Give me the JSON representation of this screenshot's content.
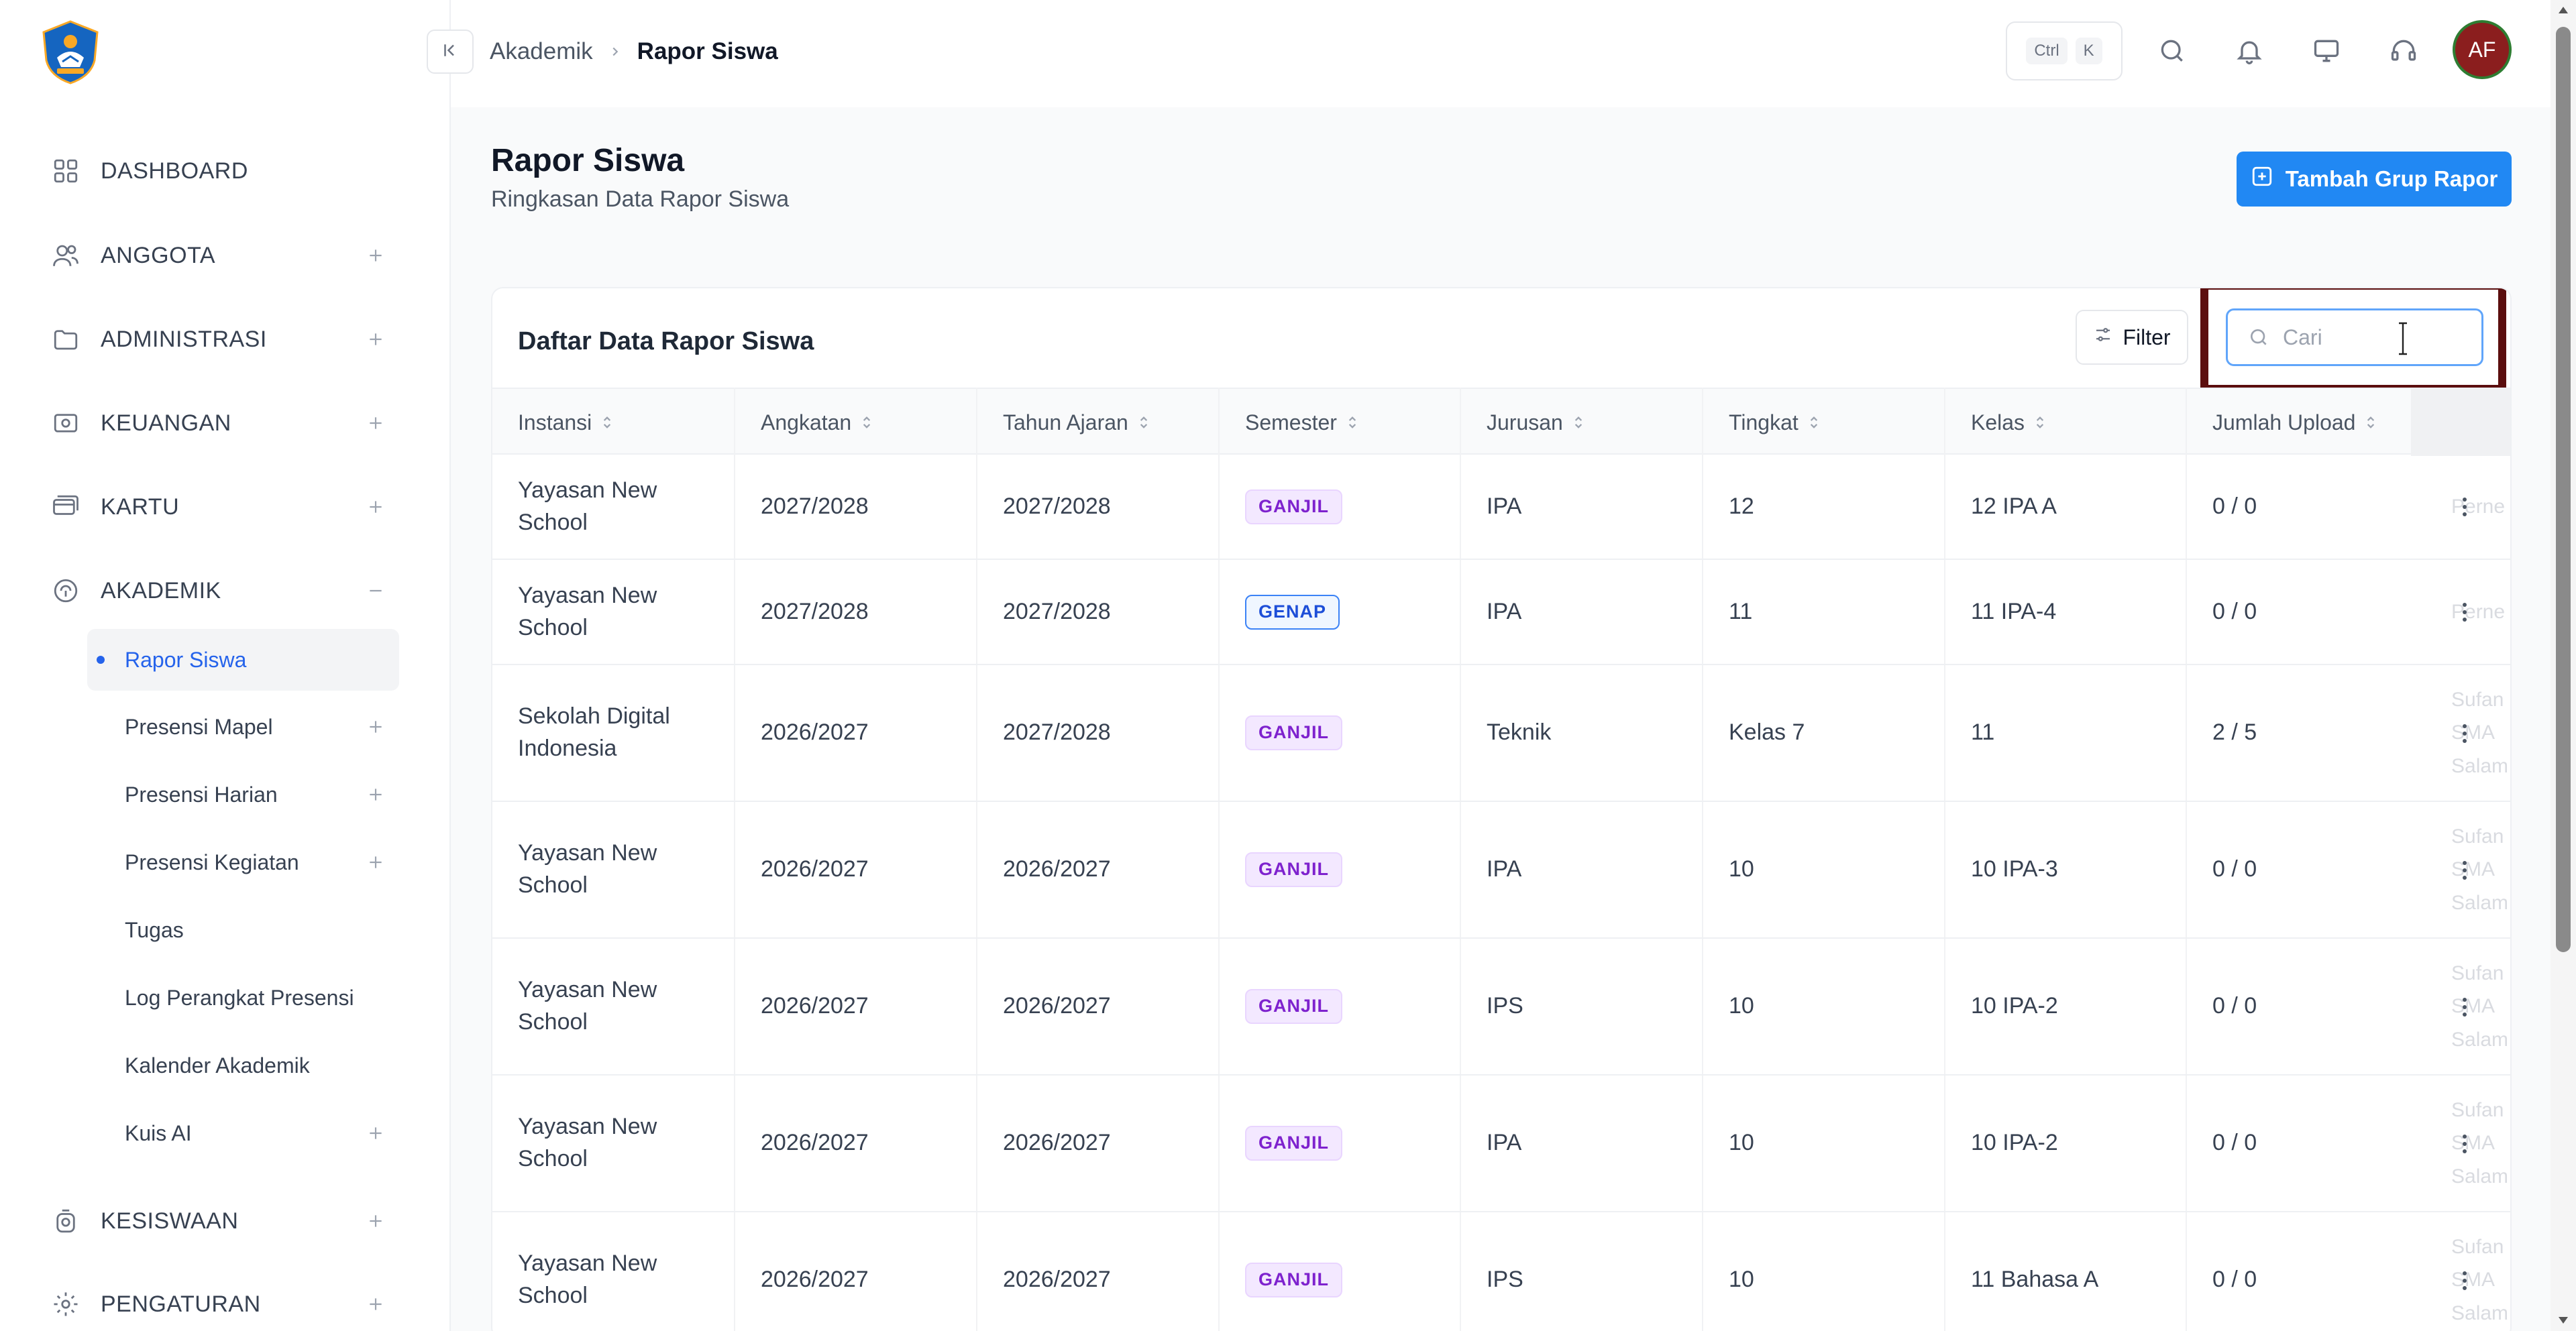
{
  "sidebar": {
    "items": [
      {
        "label": "DASHBOARD",
        "icon": "dashboard-grid-icon"
      },
      {
        "label": "ANGGOTA",
        "icon": "users-icon"
      },
      {
        "label": "ADMINISTRASI",
        "icon": "folder-icon"
      },
      {
        "label": "KEUANGAN",
        "icon": "money-icon"
      },
      {
        "label": "KARTU",
        "icon": "card-icon"
      },
      {
        "label": "AKADEMIK",
        "icon": "academic-icon"
      },
      {
        "label": "KESISWAAN",
        "icon": "student-icon"
      },
      {
        "label": "PENGATURAN",
        "icon": "settings-icon"
      }
    ],
    "subitems": [
      {
        "label": "Rapor Siswa",
        "active": true
      },
      {
        "label": "Presensi Mapel"
      },
      {
        "label": "Presensi Harian"
      },
      {
        "label": "Presensi Kegiatan"
      },
      {
        "label": "Tugas"
      },
      {
        "label": "Log Perangkat Presensi"
      },
      {
        "label": "Kalender Akademik"
      },
      {
        "label": "Kuis AI"
      }
    ]
  },
  "header": {
    "breadcrumb_parent": "Akademik",
    "breadcrumb_current": "Rapor Siswa",
    "shortcut_ctrl": "Ctrl",
    "shortcut_key": "K",
    "avatar_initials": "AF"
  },
  "page": {
    "title": "Rapor Siswa",
    "subtitle": "Ringkasan Data Rapor Siswa",
    "add_button": "Tambah Grup Rapor"
  },
  "card": {
    "title": "Daftar Data Rapor Siswa",
    "filter_label": "Filter",
    "search_placeholder": "Cari"
  },
  "table": {
    "columns": [
      "Instansi",
      "Angkatan",
      "Tahun Ajaran",
      "Semester",
      "Jurusan",
      "Tingkat",
      "Kelas",
      "Jumlah Upload"
    ],
    "rows": [
      {
        "instansi": "Yayasan New School",
        "angkatan": "2027/2028",
        "tahun": "2027/2028",
        "semester": "GANJIL",
        "jurusan": "IPA",
        "tingkat": "12",
        "kelas": "12 IPA A",
        "upload": "0 / 0",
        "extra": "Perne"
      },
      {
        "instansi": "Yayasan New School",
        "angkatan": "2027/2028",
        "tahun": "2027/2028",
        "semester": "GENAP",
        "jurusan": "IPA",
        "tingkat": "11",
        "kelas": "11 IPA-4",
        "upload": "0 / 0",
        "extra": "Perne"
      },
      {
        "instansi": "Sekolah Digital Indonesia",
        "angkatan": "2026/2027",
        "tahun": "2027/2028",
        "semester": "GANJIL",
        "jurusan": "Teknik",
        "tingkat": "Kelas 7",
        "kelas": "11",
        "upload": "2 / 5",
        "extra": "Sufan SMA Salam"
      },
      {
        "instansi": "Yayasan New School",
        "angkatan": "2026/2027",
        "tahun": "2026/2027",
        "semester": "GANJIL",
        "jurusan": "IPA",
        "tingkat": "10",
        "kelas": "10 IPA-3",
        "upload": "0 / 0",
        "extra": "Sufan SMA Salam"
      },
      {
        "instansi": "Yayasan New School",
        "angkatan": "2026/2027",
        "tahun": "2026/2027",
        "semester": "GANJIL",
        "jurusan": "IPS",
        "tingkat": "10",
        "kelas": "10 IPA-2",
        "upload": "0 / 0",
        "extra": "Sufan SMA Salam"
      },
      {
        "instansi": "Yayasan New School",
        "angkatan": "2026/2027",
        "tahun": "2026/2027",
        "semester": "GANJIL",
        "jurusan": "IPA",
        "tingkat": "10",
        "kelas": "10 IPA-2",
        "upload": "0 / 0",
        "extra": "Sufan SMA Salam"
      },
      {
        "instansi": "Yayasan New School",
        "angkatan": "2026/2027",
        "tahun": "2026/2027",
        "semester": "GANJIL",
        "jurusan": "IPS",
        "tingkat": "10",
        "kelas": "11 Bahasa A",
        "upload": "0 / 0",
        "extra": "Sufan SMA Salam"
      }
    ]
  },
  "colors": {
    "accent": "#2188f3",
    "ganjil": "#7e22ce",
    "genap": "#1d4ed8",
    "highlight_box": "#5b0e0e",
    "avatar_bg": "#8b1e1e"
  }
}
